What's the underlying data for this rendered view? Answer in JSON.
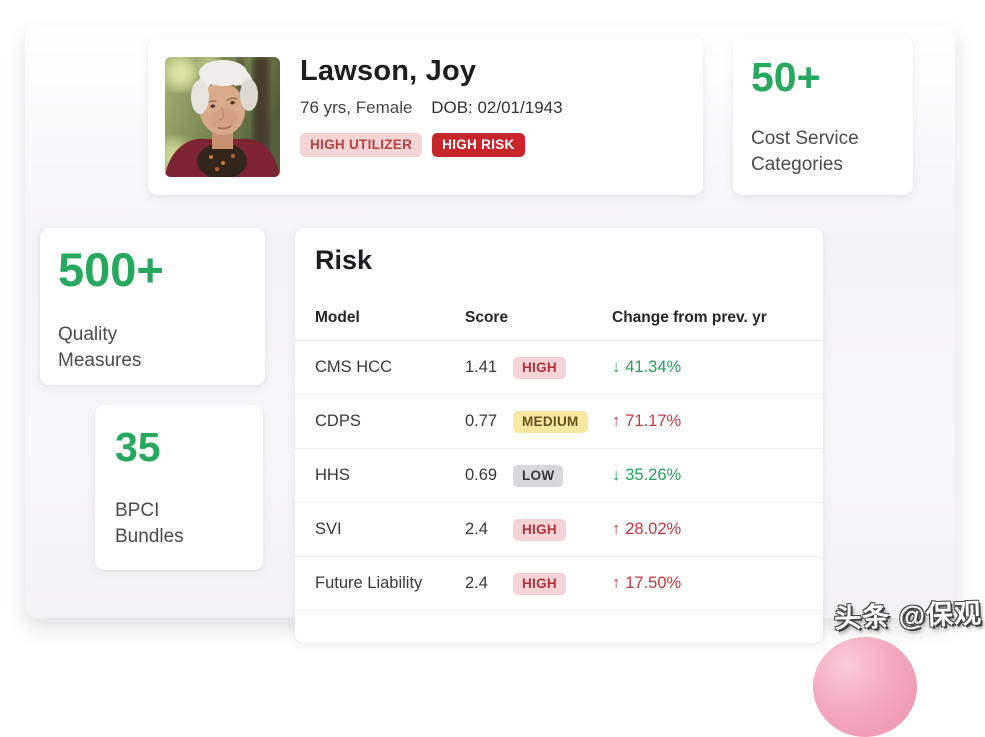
{
  "patient": {
    "name": "Lawson, Joy",
    "age": "76 yrs,",
    "sex": "Female",
    "dob": "DOB: 02/01/1943",
    "badges": [
      {
        "label": "HIGH UTILIZER"
      },
      {
        "label": "HIGH RISK"
      }
    ],
    "photo_alt": "elderly-woman-portrait"
  },
  "stats": {
    "cost": {
      "value": "50+",
      "label": "Cost Service Categories"
    },
    "quality": {
      "value": "500+",
      "label": "Quality Measures"
    },
    "bpci": {
      "value": "35",
      "label": "BPCI Bundles"
    }
  },
  "risk": {
    "title": "Risk",
    "columns": [
      "Model",
      "Score",
      "Change from prev. yr"
    ],
    "rows": [
      {
        "model": "CMS HCC",
        "score": "1.41",
        "level": "HIGH",
        "direction": "down",
        "arrow": "↓",
        "change": "41.34%"
      },
      {
        "model": "CDPS",
        "score": "0.77",
        "level": "MEDIUM",
        "direction": "up",
        "arrow": "↑",
        "change": "71.17%"
      },
      {
        "model": "HHS",
        "score": "0.69",
        "level": "LOW",
        "direction": "down",
        "arrow": "↓",
        "change": "35.26%"
      },
      {
        "model": "SVI",
        "score": "2.4",
        "level": "HIGH",
        "direction": "up",
        "arrow": "↑",
        "change": "28.02%"
      },
      {
        "model": "Future Liability",
        "score": "2.4",
        "level": "HIGH",
        "direction": "up",
        "arrow": "↑",
        "change": "17.50%"
      }
    ]
  },
  "watermark": "头条 @保观",
  "colors": {
    "accent_green": "#27a85f",
    "alert_red": "#c5262c",
    "change_up_red": "#c2383e",
    "change_down_green": "#27a05a",
    "badge_high_bg": "#f6d3d6",
    "badge_medium_bg": "#f9e8a2",
    "badge_low_bg": "#d8d8da"
  }
}
